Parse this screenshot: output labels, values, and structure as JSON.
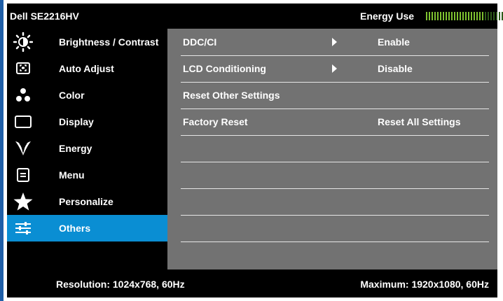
{
  "header": {
    "model": "Dell SE2216HV",
    "energy_label": "Energy Use",
    "energy_level": 0.75,
    "energy_color": "#7ec230"
  },
  "sidebar": {
    "items": [
      {
        "label": "Brightness / Contrast",
        "icon": "brightness-icon"
      },
      {
        "label": "Auto Adjust",
        "icon": "auto-adjust-icon"
      },
      {
        "label": "Color",
        "icon": "color-icon"
      },
      {
        "label": "Display",
        "icon": "display-icon"
      },
      {
        "label": "Energy",
        "icon": "energy-icon"
      },
      {
        "label": "Menu",
        "icon": "menu-icon"
      },
      {
        "label": "Personalize",
        "icon": "star-icon"
      },
      {
        "label": "Others",
        "icon": "sliders-icon",
        "active": true
      }
    ],
    "active_color": "#0a8ed3"
  },
  "content": {
    "rows": [
      {
        "label": "DDC/CI",
        "has_submenu": true,
        "value": "Enable"
      },
      {
        "label": "LCD Conditioning",
        "has_submenu": true,
        "value": "Disable"
      },
      {
        "label": "Reset Other Settings",
        "has_submenu": false,
        "value": ""
      },
      {
        "label": "Factory Reset",
        "has_submenu": false,
        "value": "Reset All Settings"
      },
      {
        "label": "",
        "has_submenu": false,
        "value": ""
      },
      {
        "label": "",
        "has_submenu": false,
        "value": ""
      },
      {
        "label": "",
        "has_submenu": false,
        "value": ""
      },
      {
        "label": "",
        "has_submenu": false,
        "value": ""
      }
    ]
  },
  "footer": {
    "resolution": "Resolution: 1024x768, 60Hz",
    "maximum": "Maximum: 1920x1080, 60Hz"
  }
}
